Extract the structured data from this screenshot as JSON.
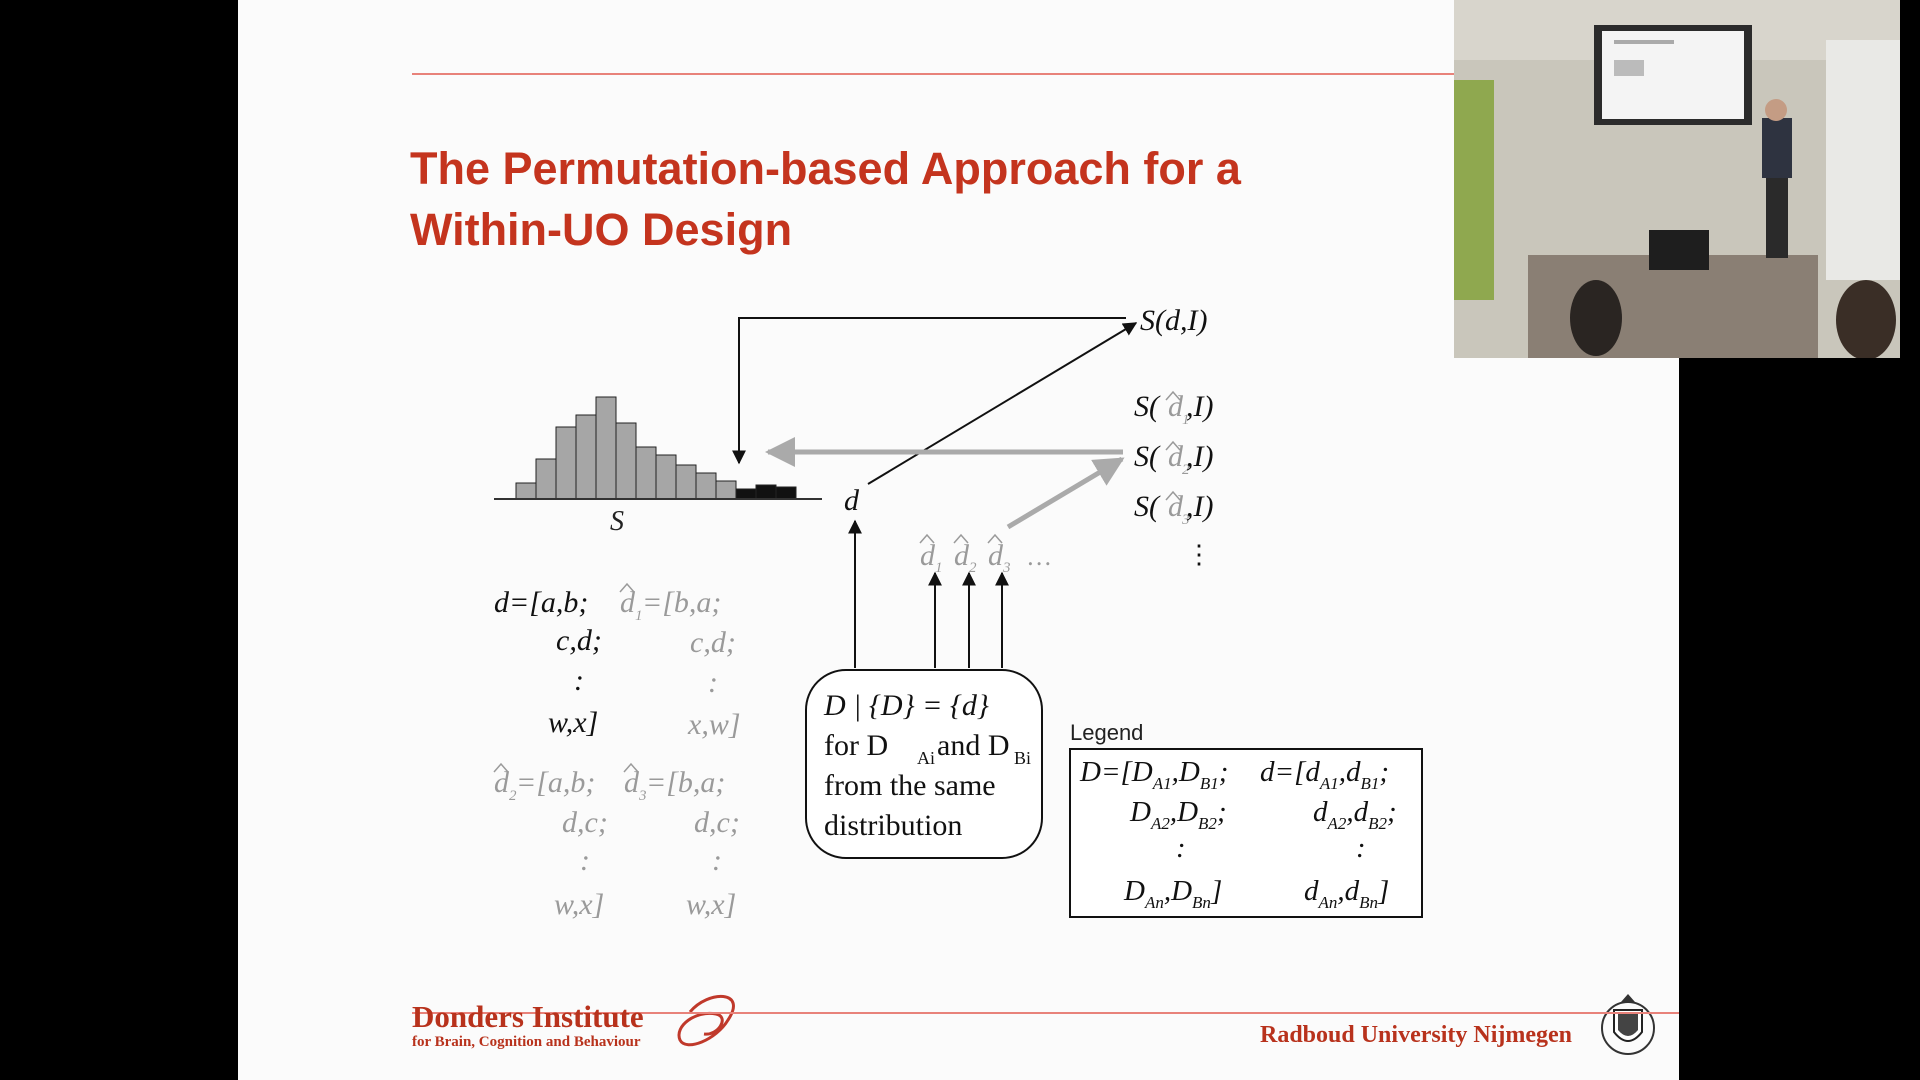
{
  "slide": {
    "title_line1": "The Permutation-based Approach for a",
    "title_line2": "Within-UO Design"
  },
  "diagram": {
    "histogram_label": "S",
    "d_label": "d",
    "stat_observed": "S(d,I)",
    "stat_perm": [
      {
        "pre": "S(",
        "sym": "d",
        "sub": "1",
        "post": " ,I)"
      },
      {
        "pre": "S(",
        "sym": "d",
        "sub": "2",
        "post": " ,I)"
      },
      {
        "pre": "S(",
        "sym": "d",
        "sub": "3",
        "post": " ,I)"
      }
    ],
    "vdots": "⋮",
    "ellipsis": "…",
    "dhat_subs": [
      "1",
      "2",
      "3"
    ],
    "box_lines": [
      "D | {D} = {d}",
      "for D",
      "Ai",
      " and D",
      "Bi",
      "from the same",
      "distribution"
    ],
    "d_left": [
      "d=[a,b;",
      "c,d;",
      ":",
      "w,x]"
    ],
    "d1_right": [
      "=[b,a;",
      "c,d;",
      ":",
      "x,w]"
    ],
    "d2_left": [
      "=[a,b;",
      "d,c;",
      ":",
      "w,x]"
    ],
    "d3_right": [
      "=[b,a;",
      "d,c;",
      ":",
      "w,x]"
    ]
  },
  "legend": {
    "title": "Legend",
    "D_row1": [
      "D=[D",
      "A1",
      ",D",
      "B1",
      ";"
    ],
    "D_row2": [
      "D",
      "A2",
      ",D",
      "B2",
      ";"
    ],
    "D_row3": ":",
    "D_row4": [
      "D",
      "An",
      ",D",
      "Bn",
      "]"
    ],
    "d_row1": [
      "d=[d",
      "A1",
      ",d",
      "B1",
      ";"
    ],
    "d_row2": [
      "d",
      "A2",
      ",d",
      "B2",
      ";"
    ],
    "d_row3": ":",
    "d_row4": [
      "d",
      "An",
      ",d",
      "Bn",
      "]"
    ]
  },
  "footer": {
    "institute": "Donders Institute",
    "institute_sub": "for Brain, Cognition and Behaviour",
    "university": "Radboud University Nijmegen"
  },
  "colors": {
    "title": "#c4341e",
    "rule": "#e8827a",
    "gray_text": "#9a9a9a",
    "bar": "#a6a6a6",
    "bar_tail": "#111111"
  }
}
